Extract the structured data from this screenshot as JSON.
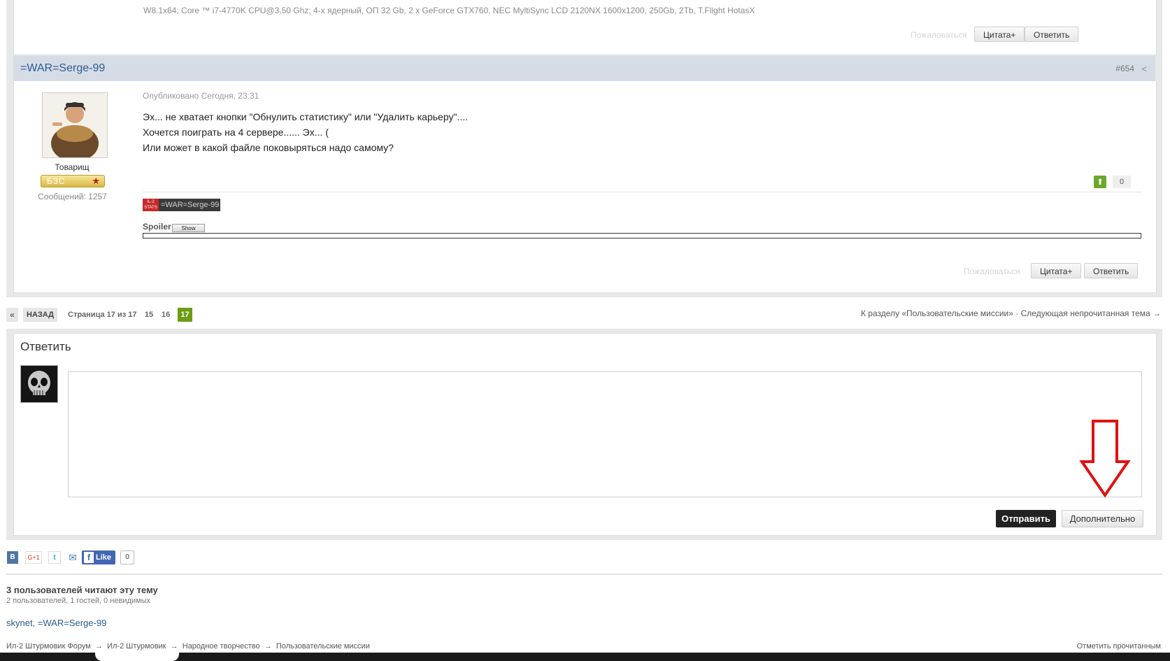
{
  "prev_post": {
    "signature": "W8.1x64; Core ™ i7-4770K CPU@3,50 Ghz; 4-х ядерный, ОП 32 Gb, 2 x GeForce GTX760, NEC MyltiSync LCD 2120NX 1600x1200, 250Gb, 2Tb, T.Flight HotasX",
    "report_label": "Пожаловаться",
    "quote_label": "Цитата+",
    "reply_label": "Ответить"
  },
  "post": {
    "author": "=WAR=Serge-99",
    "number": "#654",
    "rank_title": "Товарищ",
    "rank_badge": "БЗС",
    "posts_count": "Сообщений: 1257",
    "published": "Опубликовано Сегодня, 23:31",
    "lines": [
      "Эх... не хватает кнопки \"Обнулить статистику\" или \"Удалить карьеру\"....",
      "Хочется поиграть на 4 сервере...... Эх... (",
      "Или может в какой файле поковыряться надо самому?"
    ],
    "reputation": "0",
    "stats_logo": "IL-2 STATS",
    "stats_nick": "=WAR=Serge-99",
    "spoiler_label": "Spoiler",
    "spoiler_button": "Show",
    "report_label": "Пожаловаться",
    "quote_label": "Цитата+",
    "reply_label": "Ответить"
  },
  "pagination": {
    "prev": "«",
    "back": "НАЗАД",
    "info": "Страница 17 из 17",
    "pages": [
      "15",
      "16"
    ],
    "current": "17",
    "to_section": "К разделу «Пользовательские миссии»",
    "separator": "·",
    "next_unread": "Следующая непрочитанная тема →"
  },
  "reply": {
    "title": "Ответить",
    "send_label": "Отправить",
    "more_label": "Дополнительно"
  },
  "share": {
    "vk": "В",
    "gplus": "G+1",
    "twitter": "t",
    "mail": "✉",
    "fb_like": "Like",
    "fb_count": "0"
  },
  "readers": {
    "title": "3 пользователей читают эту тему",
    "subtitle": "2 пользователей, 1 гостей, 0 невидимых",
    "users": "skynet, =WAR=Serge-99"
  },
  "breadcrumb": [
    "Ил-2 Штурмовик Форум",
    "Ил-2 Штурмовик",
    "Народное творчество",
    "Пользовательские миссии"
  ],
  "breadcrumb_sep": "→",
  "mark_read": "Отметить прочитанным",
  "colors": {
    "accent_green": "#6c9c15",
    "author_blue": "#2a5d8f",
    "arrow_red": "#e11111"
  }
}
